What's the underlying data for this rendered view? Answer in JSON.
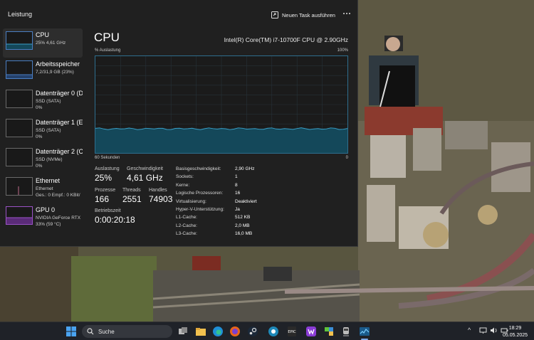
{
  "window": {
    "title": "Leistung",
    "new_task_label": "Neuen Task ausführen"
  },
  "sidebar": {
    "items": [
      {
        "name": "CPU",
        "sub": "25% 4,61 GHz",
        "sub2": ""
      },
      {
        "name": "Arbeitsspeicher",
        "sub": "7,2/31,9 GB (23%)",
        "sub2": ""
      },
      {
        "name": "Datenträger 0 (D",
        "sub": "SSD (SATA)",
        "sub2": "0%"
      },
      {
        "name": "Datenträger 1 (E",
        "sub": "SSD (SATA)",
        "sub2": "0%"
      },
      {
        "name": "Datenträger 2 (C",
        "sub": "SSD (NVMe)",
        "sub2": "0%"
      },
      {
        "name": "Ethernet",
        "sub": "Ethernet",
        "sub2": "Ges.: 0 Empf.: 0 KBit/"
      },
      {
        "name": "GPU 0",
        "sub": "NVIDIA GeForce RTX",
        "sub2": "33% (59 °C)"
      }
    ]
  },
  "cpu": {
    "heading": "CPU",
    "model": "Intel(R) Core(TM) i7-10700F CPU @ 2.90GHz",
    "graph_label_top_left": "% Auslastung",
    "graph_label_top_right": "100%",
    "graph_label_bottom_left": "60 Sekunden",
    "graph_label_bottom_right": "0",
    "usage_fraction": 0.25,
    "stats": {
      "auslastung_label": "Auslastung",
      "auslastung_value": "25%",
      "geschwindigkeit_label": "Geschwindigkeit",
      "geschwindigkeit_value": "4,61 GHz",
      "prozesse_label": "Prozesse",
      "prozesse_value": "166",
      "threads_label": "Threads",
      "threads_value": "2551",
      "handles_label": "Handles",
      "handles_value": "74903",
      "betriebszeit_label": "Betriebszeit",
      "betriebszeit_value": "0:00:20:18"
    },
    "info": [
      {
        "k": "Basisgeschwindigkeit:",
        "v": "2,90 GHz"
      },
      {
        "k": "Sockets:",
        "v": "1"
      },
      {
        "k": "Kerne:",
        "v": "8"
      },
      {
        "k": "Logische Prozessoren:",
        "v": "16"
      },
      {
        "k": "Virtualisierung:",
        "v": "Deaktiviert"
      },
      {
        "k": "Hyper-V-Unterstützung:",
        "v": "Ja"
      },
      {
        "k": "L1-Cache:",
        "v": "512 KB"
      },
      {
        "k": "L2-Cache:",
        "v": "2,0 MB"
      },
      {
        "k": "L3-Cache:",
        "v": "16,0 MB"
      }
    ]
  },
  "taskbar": {
    "search_label": "Suche",
    "time": "18:29",
    "date": "05.05.2025"
  },
  "colors": {
    "accent_cpu": "#4a7ec2",
    "graph_line": "#3aa0c8",
    "graph_fill": "#14485a",
    "gpu_purple": "#9a53c6"
  }
}
